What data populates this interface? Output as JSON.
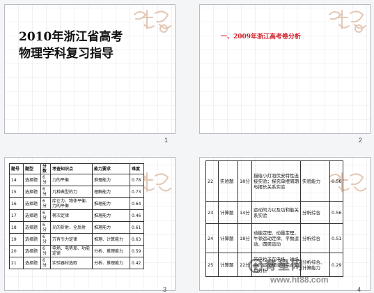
{
  "slides": [
    {
      "number": "1",
      "title_line1": "2010年浙江省高考",
      "title_line2": "物理学科复习指导"
    },
    {
      "number": "2",
      "heading": "一、2009年浙江高考卷分析"
    },
    {
      "number": "3",
      "table": {
        "headers": [
          "题号",
          "题型",
          "分数",
          "考查知识点",
          "能力要求",
          "难度"
        ],
        "rows": [
          [
            "14",
            "选择题",
            "6分",
            "力的平衡",
            "推理能力",
            "0.78"
          ],
          [
            "15",
            "选择题",
            "6分",
            "几种典型的力",
            "理解能力",
            "0.73"
          ],
          [
            "16",
            "选择题",
            "6分",
            "库仑力、物体平衡、力的平衡",
            "推理能力",
            "0.64"
          ],
          [
            "17",
            "选择题",
            "6分",
            "楞次定律",
            "推理能力",
            "0.46"
          ],
          [
            "18",
            "选择题",
            "6分",
            "光的折射、全反射",
            "推理能力",
            "0.61"
          ],
          [
            "19",
            "选择题",
            "6分",
            "万有引力定律",
            "推理、计算能力",
            "0.63"
          ],
          [
            "20",
            "选择题",
            "6分",
            "电场、电势差、功能定律",
            "分析、推理能力",
            "0.59"
          ],
          [
            "21",
            "选择题",
            "6分",
            "实验器材选取",
            "分析、推理能力",
            "0.42"
          ]
        ]
      }
    },
    {
      "number": "4",
      "table": {
        "rows": [
          [
            "22",
            "实验题",
            "18分",
            "描绘小灯泡伏安特性连接实验；探究单摆周期与摆长关系实验",
            "实验能力",
            "0.56"
          ],
          [
            "23",
            "计算题",
            "14分",
            "运动的力以及功和能关系实验",
            "分析综合",
            "0.56"
          ],
          [
            "24",
            "计算题",
            "18分",
            "动能定理、动量定理、牛顿运动定律、平抛运动、圆周运动",
            "分析综合",
            "0.51"
          ],
          [
            "25",
            "计算题",
            "22分",
            "带电粒子在电场、磁场中的运动规律的综合运用分析",
            "分析综合、计算能力",
            "0.29"
          ]
        ]
      }
    }
  ],
  "watermark": {
    "text": "育星网",
    "url": "www.ht88.com"
  },
  "colors": {
    "heading_red": "#d0202a",
    "slide_border": "#b9bcc0",
    "background": "#f4f5f6"
  },
  "icons": {
    "seal": "decorative-seal-icon",
    "logo": "watermark-logo-icon"
  }
}
